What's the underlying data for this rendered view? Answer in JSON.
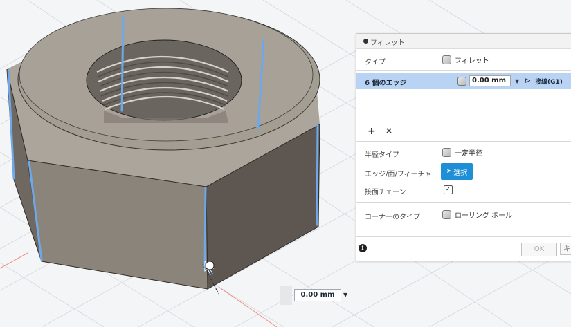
{
  "panel": {
    "title": "フィレット",
    "type_label": "タイプ",
    "type_value": "フィレット",
    "edges_label": "6 個のエッジ",
    "radius_value": "0.00 mm",
    "continuity_value": "接線(G1)",
    "add_symbol": "+",
    "remove_symbol": "×",
    "radius_type_label": "半径タイプ",
    "radius_type_value": "一定半径",
    "edge_face_label": "エッジ/面/フィーチャ",
    "select_button": "選択",
    "tangent_chain_label": "接面チェーン",
    "tangent_chain_checked": "✓",
    "corner_type_label": "コーナーのタイプ",
    "corner_type_value": "ローリング ボール",
    "info_symbol": "i",
    "ok_label": "OK",
    "cancel_label": "キ"
  },
  "inline_input": {
    "value": "0.00 mm"
  },
  "colors": {
    "accent": "#1e8ed6",
    "selected_row": "#b9d3f4",
    "edge_highlight": "#6fa8e8",
    "nut_dark": "#5e5650",
    "nut_mid": "#8b847b",
    "nut_light": "#aca59b"
  },
  "icons": [
    "fillet-icon",
    "constant-radius-icon",
    "continuity-icon",
    "select-arrow-icon",
    "corner-rolling-ball-icon",
    "info-icon",
    "dropdown-arrow-icon",
    "cursor-icon"
  ]
}
